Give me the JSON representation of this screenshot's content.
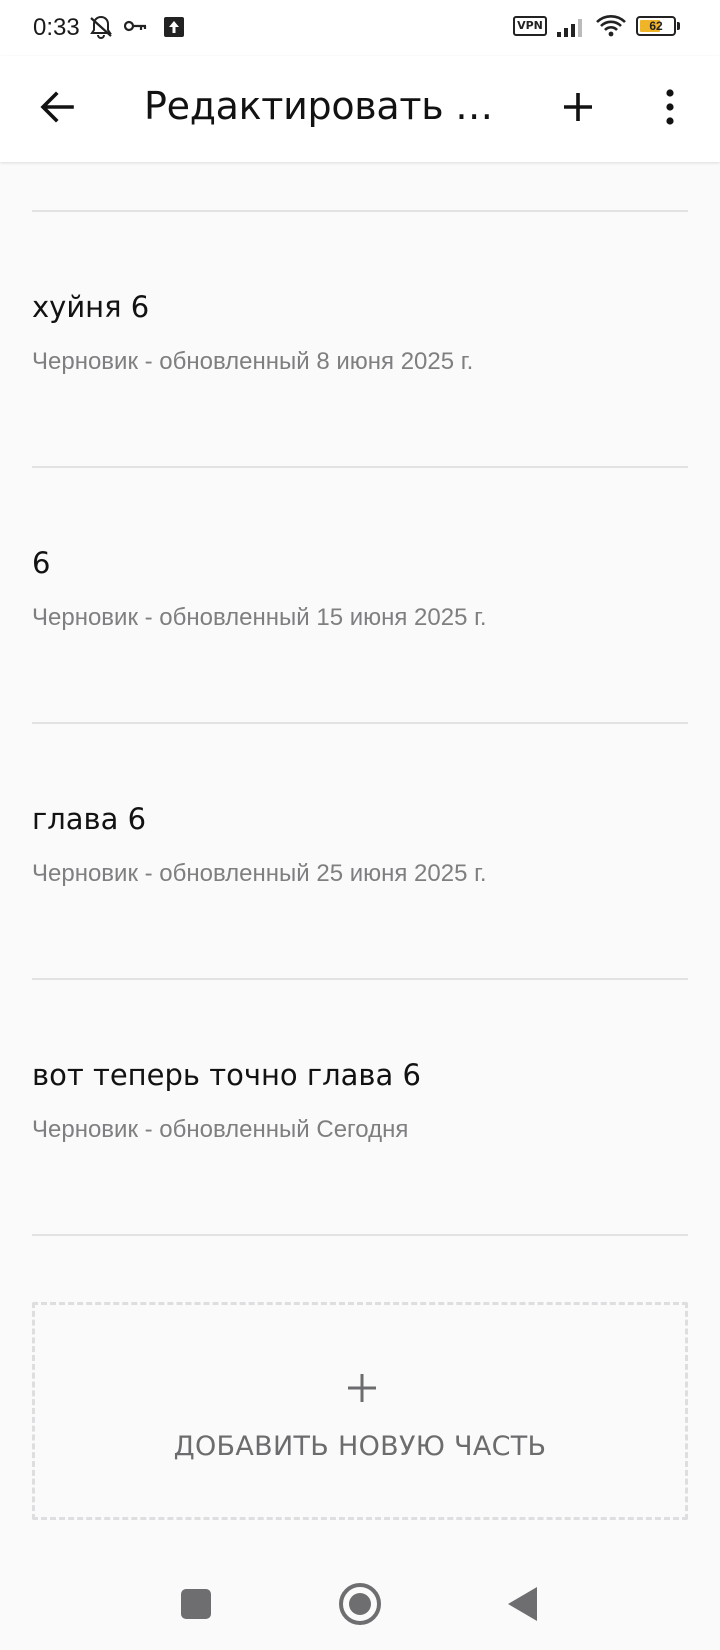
{
  "status_bar": {
    "time": "0:33",
    "vpn_label": "VPN",
    "battery_level": "62",
    "battery_fraction": 0.62,
    "icons": [
      "mute-notifications-icon",
      "key-icon",
      "upload-icon",
      "vpn-icon",
      "signal-icon",
      "wifi-icon",
      "battery-icon"
    ]
  },
  "app_bar": {
    "title": "Редактировать и…",
    "icons": [
      "arrow-back-icon",
      "plus-icon",
      "more-vertical-icon"
    ]
  },
  "parts": [
    {
      "title": "хуйня 6",
      "status": "Черновик - обновленный 8 июня 2025 г."
    },
    {
      "title": "6",
      "status": "Черновик - обновленный 15 июня 2025 г."
    },
    {
      "title": "глава 6",
      "status": "Черновик - обновленный 25 июня 2025 г."
    },
    {
      "title": "вот теперь точно глава 6",
      "status": "Черновик - обновленный Сегодня"
    }
  ],
  "add_part": {
    "label": "ДОБАВИТЬ НОВУЮ ЧАСТЬ",
    "icon": "plus-icon"
  },
  "nav_bar": {
    "icons": [
      "recents-square-icon",
      "home-circle-icon",
      "back-triangle-icon"
    ]
  },
  "colors": {
    "background": "#fbfafb",
    "text_primary": "#121212",
    "text_secondary": "#7f7e80",
    "divider": "#e2e1e3",
    "battery_accent": "#f0b429"
  }
}
